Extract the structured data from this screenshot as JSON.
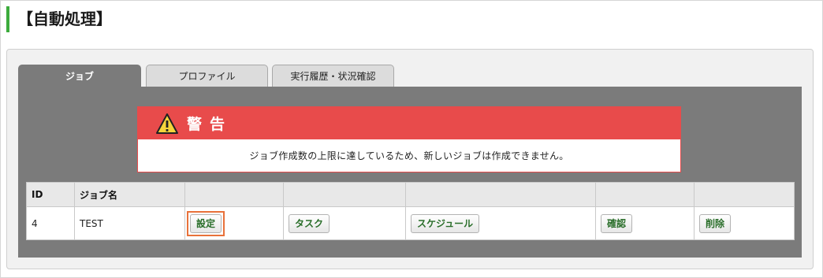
{
  "page": {
    "title": "【自動処理】"
  },
  "tabs": [
    {
      "label": "ジョブ",
      "active": true
    },
    {
      "label": "プロファイル",
      "active": false
    },
    {
      "label": "実行履歴・状況確認",
      "active": false
    }
  ],
  "warning": {
    "icon": "warning-triangle-icon",
    "title": "警告",
    "message": "ジョブ作成数の上限に達しているため、新しいジョブは作成できません。"
  },
  "table": {
    "headers": [
      "ID",
      "ジョブ名",
      "",
      "",
      "",
      "",
      ""
    ],
    "rows": [
      {
        "id": "4",
        "name": "TEST",
        "buttons": {
          "settings": "設定",
          "task": "タスク",
          "schedule": "スケジュール",
          "confirm": "確認",
          "delete": "削除"
        }
      }
    ]
  },
  "colors": {
    "accent_bar": "#3cab3c",
    "warning": "#e84b4b",
    "tab_active": "#7b7b7b",
    "button_text": "#2a6e2a",
    "highlight": "#e8713a"
  }
}
